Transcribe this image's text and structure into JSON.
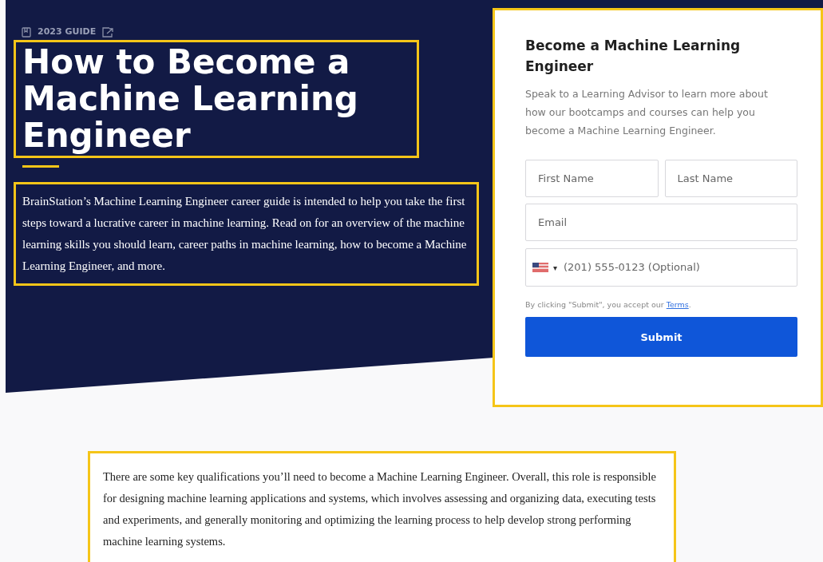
{
  "hero": {
    "eyebrow": "2023 GUIDE",
    "title": "How to Become a Machine Learning Engineer",
    "intro": "BrainStation’s Machine Learning Engineer career guide is intended to help you take the first steps toward a lucrative career in machine learning. Read on for an overview of the machine learning skills you should learn, career paths in machine learning, how to become a Machine Learning Engineer, and more."
  },
  "form": {
    "title": "Become a Machine Learning Engineer",
    "description": "Speak to a Learning Advisor to learn more about how our bootcamps and courses can help you become a Machine Learning Engineer.",
    "fields": [
      {
        "placeholder": "First Name"
      },
      {
        "placeholder": "Last Name"
      },
      {
        "placeholder": "Email"
      }
    ],
    "phone": {
      "placeholder": "(201) 555-0123 (Optional)",
      "caret": "▾"
    },
    "consent": "By clicking \"Submit\", you accept our",
    "terms_link": "Terms",
    "consent_end": ".",
    "submit": "Submit"
  },
  "body": {
    "paragraph": "There are some key qualifications you’ll need to become a Machine Learning Engineer. Overall, this role is responsible for designing machine learning applications and systems, which involves assessing and organizing data, executing tests and experiments, and generally monitoring and optimizing the learning process to help develop strong performing machine learning systems."
  }
}
